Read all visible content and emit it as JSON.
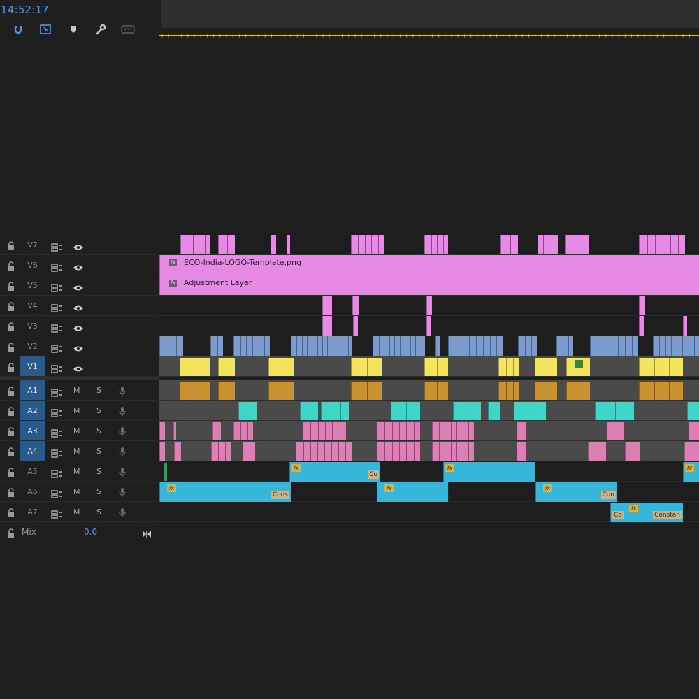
{
  "timecode": "14:52:17",
  "toolbar": {
    "snap_icon": "snap-magnet-icon",
    "linked_icon": "linked-selection-icon",
    "marker_icon": "add-marker-icon",
    "settings_icon": "wrench-settings-icon",
    "captions_label": "CC"
  },
  "colors": {
    "accent": "#4b9be8",
    "playhead": "#e2c323",
    "v_top": "#e68ae6",
    "v_blue": "#7a9cce",
    "v_yellow": "#f4e35d",
    "a_gold": "#c9922e",
    "a_teal": "#3fd6c8",
    "a_pink": "#dd7fb4",
    "a_cyan": "#36b6d9",
    "track_fill": "#4a4a4a"
  },
  "video_tracks": [
    {
      "name": "V7",
      "active": false
    },
    {
      "name": "V6",
      "active": false
    },
    {
      "name": "V5",
      "active": false
    },
    {
      "name": "V4",
      "active": false
    },
    {
      "name": "V3",
      "active": false
    },
    {
      "name": "V2",
      "active": false
    },
    {
      "name": "V1",
      "active": true
    }
  ],
  "audio_tracks": [
    {
      "name": "A1",
      "active": true,
      "m": "M",
      "s": "S"
    },
    {
      "name": "A2",
      "active": true,
      "m": "M",
      "s": "S"
    },
    {
      "name": "A3",
      "active": true,
      "m": "M",
      "s": "S"
    },
    {
      "name": "A4",
      "active": true,
      "m": "M",
      "s": "S"
    },
    {
      "name": "A5",
      "active": false,
      "m": "M",
      "s": "S"
    },
    {
      "name": "A6",
      "active": false,
      "m": "M",
      "s": "S"
    },
    {
      "name": "A7",
      "active": false,
      "m": "M",
      "s": "S"
    }
  ],
  "mix": {
    "label": "Mix",
    "value": "0.0"
  },
  "clips": {
    "v6_name": "ECO-India-LOGO-Template.png",
    "v5_name": "Adjustment Layer",
    "fx": "fx",
    "a5_tail": "Co",
    "a6_label": "Cons",
    "a6_label_b": "Con",
    "a7_head": "Co",
    "a7_label": "Constan"
  }
}
